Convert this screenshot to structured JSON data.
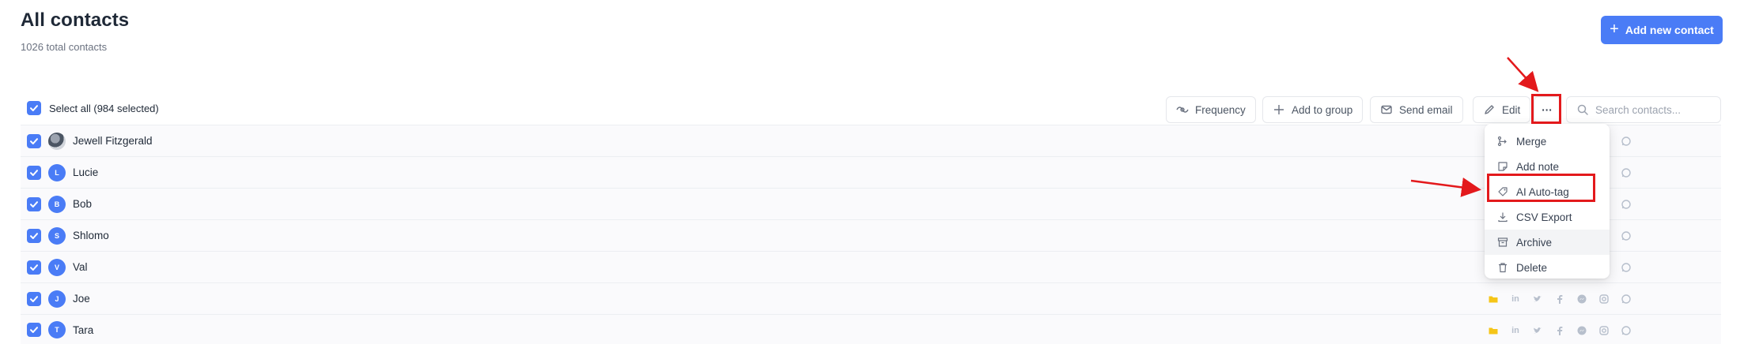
{
  "header": {
    "title": "All contacts",
    "subtitle": "1026 total contacts"
  },
  "add_button": {
    "label": "Add new contact"
  },
  "toolbar": {
    "select_all": "Select all (984 selected)",
    "frequency": "Frequency",
    "add_to_group": "Add to group",
    "send_email": "Send email",
    "edit": "Edit",
    "more": "···",
    "search_placeholder": "Search contacts..."
  },
  "contacts": [
    {
      "name": "Jewell Fitzgerald",
      "initial": ""
    },
    {
      "name": "Lucie",
      "initial": "L"
    },
    {
      "name": "Bob",
      "initial": "B"
    },
    {
      "name": "Shlomo",
      "initial": "S"
    },
    {
      "name": "Val",
      "initial": "V"
    },
    {
      "name": "Joe",
      "initial": "J"
    },
    {
      "name": "Tara",
      "initial": "T"
    }
  ],
  "menu": {
    "items": [
      {
        "label": "Merge",
        "icon": "merge-icon"
      },
      {
        "label": "Add note",
        "icon": "note-icon"
      },
      {
        "label": "AI Auto-tag",
        "icon": "ai-tag-icon"
      },
      {
        "label": "CSV Export",
        "icon": "download-icon"
      },
      {
        "label": "Archive",
        "icon": "archive-icon"
      },
      {
        "label": "Delete",
        "icon": "trash-icon"
      }
    ]
  },
  "colors": {
    "accent": "#4a7cf6",
    "highlight": "#e3191c",
    "folder": "#f5c518"
  }
}
